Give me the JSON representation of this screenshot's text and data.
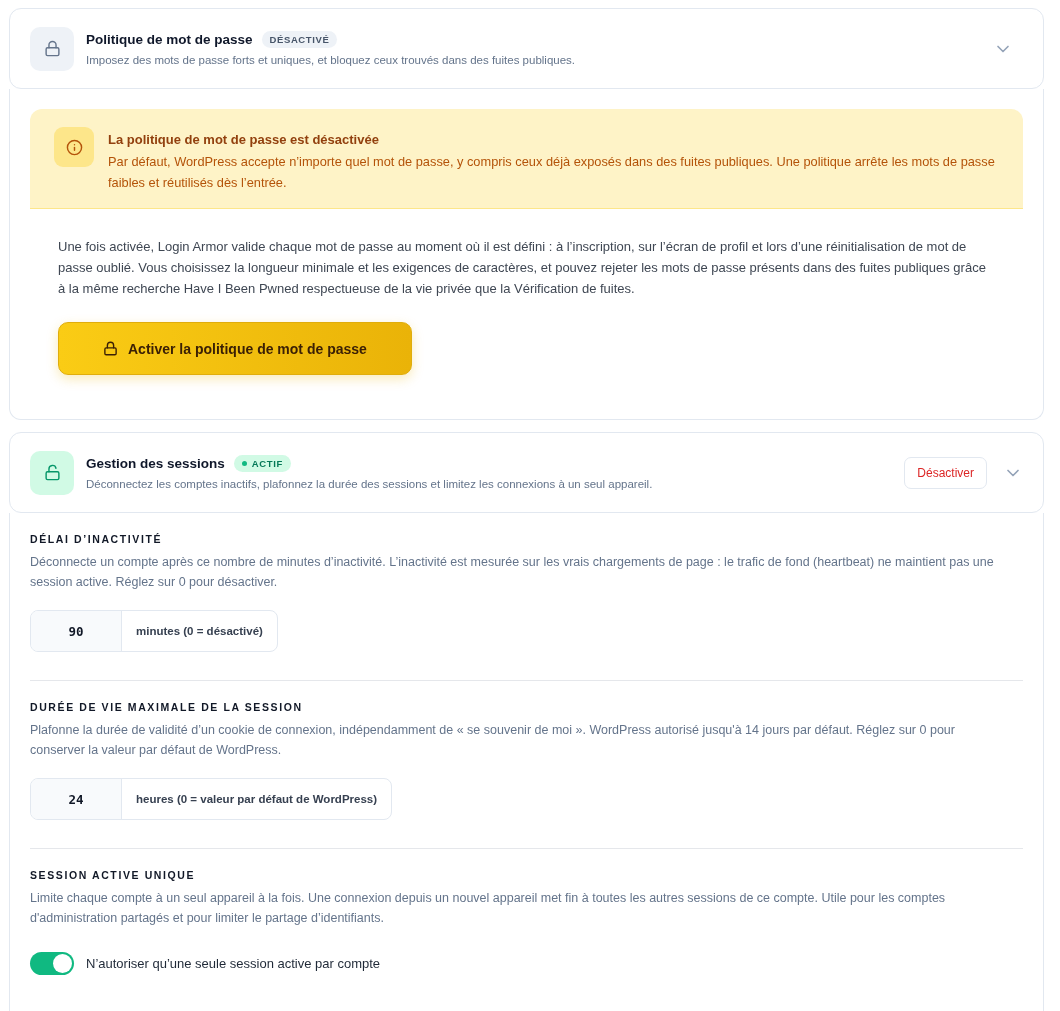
{
  "panels": [
    {
      "kind": "notice",
      "title": "Politique de mot de passe",
      "status": "DÉSACTIVÉ",
      "active": false,
      "subtitle": "Imposez des mots de passe forts et uniques, et bloquez ceux trouvés dans des fuites publiques.",
      "notice": {
        "title": "La politique de mot de passe est désactivée",
        "text": "Par défaut, WordPress accepte n’importe quel mot de passe, y compris ceux déjà exposés dans des fuites publiques. Une politique arrête les mots de passe faibles et réutilisés dès l’entrée."
      },
      "description": "Une fois activée, Login Armor valide chaque mot de passe au moment où il est défini : à l’inscription, sur l’écran de profil et lors d’une réinitialisation de mot de passe oublié. Vous choisissez la longueur minimale et les exigences de caractères, et pouvez rejeter les mots de passe présents dans des fuites publiques grâce à la même recherche Have I Been Pwned respectueuse de la vie privée que la Vérification de fuites.",
      "enable_button": "Activer la politique de mot de passe"
    },
    {
      "kind": "settings",
      "title": "Gestion des sessions",
      "status": "ACTIF",
      "active": true,
      "subtitle": "Déconnectez les comptes inactifs, plafonnez la durée des sessions et limitez les connexions à un seul appareil.",
      "action_button": "Désactiver",
      "settings": [
        {
          "kind": "number",
          "heading": "DÉLAI D’INACTIVITÉ",
          "description": "Déconnecte un compte après ce nombre de minutes d’inactivité. L’inactivité est mesurée sur les vrais chargements de page : le trafic de fond (heartbeat) ne maintient pas une session active. Réglez sur 0 pour désactiver.",
          "value": "90",
          "unit": "minutes (0 = désactivé)"
        },
        {
          "kind": "number",
          "heading": "DURÉE DE VIE MAXIMALE DE LA SESSION",
          "description": "Plafonne la durée de validité d’un cookie de connexion, indépendamment de « se souvenir de moi ». WordPress autorisé jusqu'à 14 jours par défaut. Réglez sur 0 pour conserver la valeur par défaut de WordPress.",
          "value": "24",
          "unit": "heures (0 = valeur par défaut de WordPress)"
        },
        {
          "kind": "toggle",
          "heading": "SESSION ACTIVE UNIQUE",
          "description": "Limite chaque compte à un seul appareil à la fois. Une connexion depuis un nouvel appareil met fin à toutes les autres sessions de ce compte. Utile pour les comptes d'administration partagés et pour limiter le partage d’identifiants.",
          "on": true,
          "label": "N’autoriser qu’une seule session active par compte"
        }
      ]
    }
  ]
}
